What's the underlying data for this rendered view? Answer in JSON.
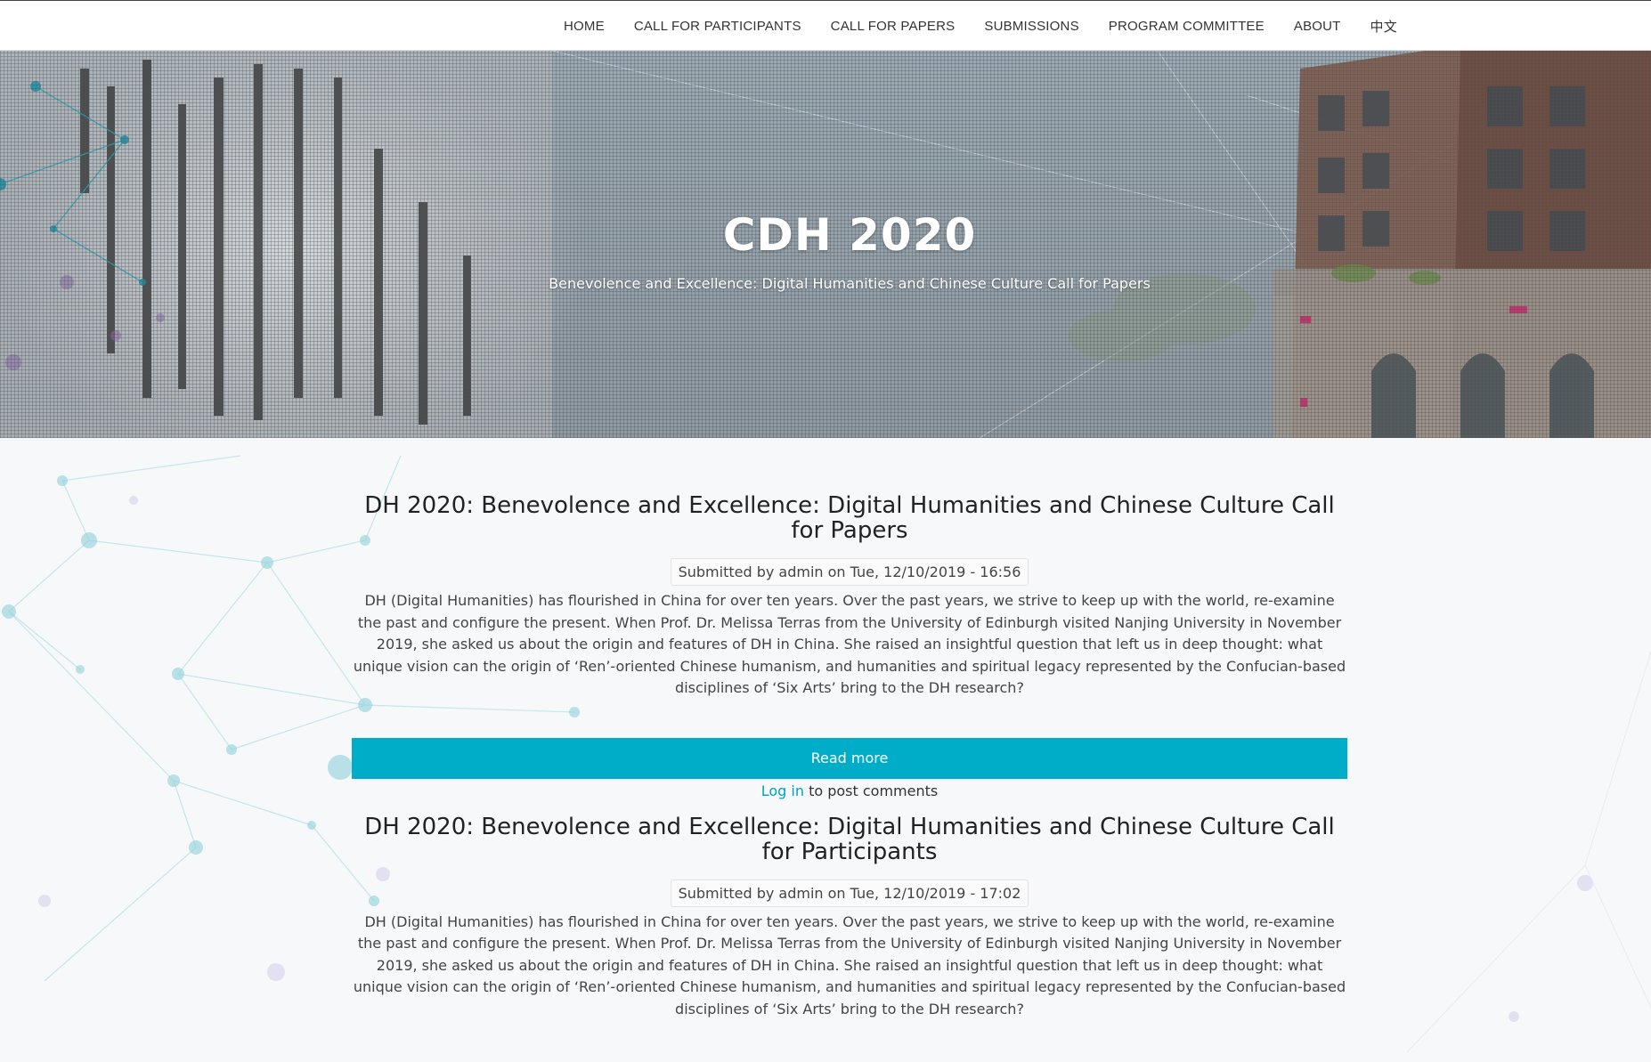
{
  "nav": {
    "items": [
      {
        "label": "HOME"
      },
      {
        "label": "CALL FOR PARTICIPANTS"
      },
      {
        "label": "CALL FOR PAPERS"
      },
      {
        "label": "SUBMISSIONS"
      },
      {
        "label": "PROGRAM COMMITTEE"
      },
      {
        "label": "ABOUT"
      },
      {
        "label": "中文"
      }
    ]
  },
  "hero": {
    "title": "CDH 2020",
    "subtitle": "Benevolence and Excellence: Digital Humanities and Chinese Culture Call for Papers"
  },
  "articles": [
    {
      "title": "DH 2020: Benevolence and Excellence: Digital Humanities and Chinese Culture Call for Papers",
      "meta": "Submitted by admin on Tue, 12/10/2019 - 16:56",
      "body": "DH (Digital Humanities) has flourished in China for over ten years. Over the past years, we strive to keep up with the world, re-examine the past and configure the present. When Prof. Dr. Melissa Terras from the University of Edinburgh visited Nanjing University in November 2019, she asked us about the origin and features of DH in China. She raised an insightful question that left us in deep thought: what unique vision can the origin of ‘Ren’-oriented Chinese humanism, and humanities and spiritual legacy represented by the Confucian-based disciplines of ‘Six Arts’ bring to the DH research?",
      "read_more": "Read more",
      "login_link": "Log in",
      "login_suffix": " to post comments"
    },
    {
      "title": "DH 2020: Benevolence and Excellence: Digital Humanities and Chinese Culture Call for Participants",
      "meta": "Submitted by admin on Tue, 12/10/2019 - 17:02",
      "body": "DH (Digital Humanities) has flourished in China for over ten years. Over the past years, we strive to keep up with the world, re-examine the past and configure the present. When Prof. Dr. Melissa Terras from the University of Edinburgh visited Nanjing University in November 2019, she asked us about the origin and features of DH in China. She raised an insightful question that left us in deep thought: what unique vision can the origin of ‘Ren’-oriented Chinese humanism, and humanities and spiritual legacy represented by the Confucian-based disciplines of ‘Six Arts’ bring to the DH research?"
    }
  ],
  "colors": {
    "accent": "#00adc9",
    "link": "#00a2c6",
    "nav_bg": "#ffffff",
    "page_bg": "#f7f8fa"
  }
}
